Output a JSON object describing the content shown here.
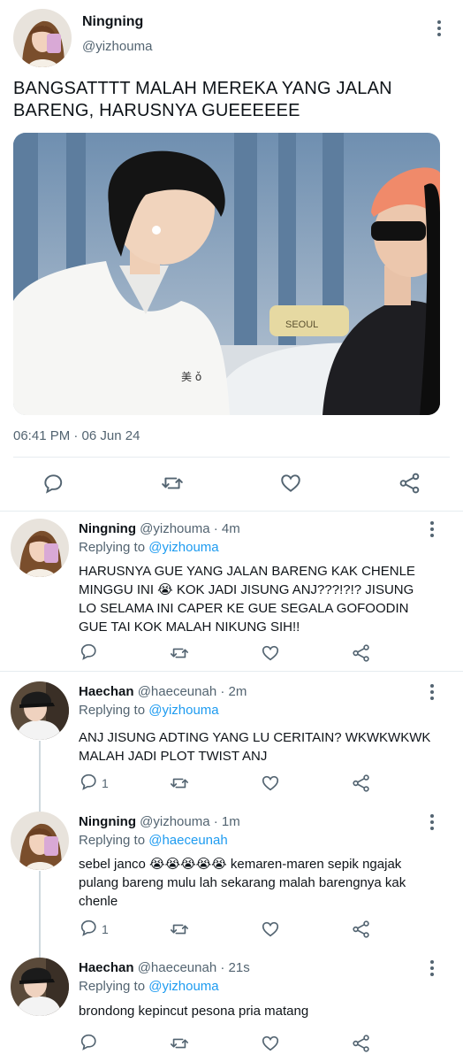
{
  "tweet": {
    "name": "Ningning",
    "handle": "@yizhouma",
    "text": "BANGSATTTT MALAH MEREKA YANG JALAN BARENG, HARUSNYA GUEEEEEE",
    "timestamp": "06:41 PM · 06 Jun 24",
    "photo_caption": "SEOUL",
    "shirt_text": "美 ǒ"
  },
  "replies": [
    {
      "name": "Ningning",
      "handle": "@yizhouma",
      "time": "· 4m",
      "replying_label": "Replying to",
      "replying_to": "@yizhouma",
      "text": "HARUSNYA GUE YANG JALAN BARENG KAK CHENLE MINGGU INI 😭 KOK JADI JISUNG ANJ???!?!? JISUNG LO SELAMA INI CAPER KE GUE SEGALA GOFOODIN GUE TAI KOK MALAH NIKUNG SIH!!",
      "reply_count": ""
    },
    {
      "name": "Haechan",
      "handle": "@haeceunah",
      "time": "· 2m",
      "replying_label": "Replying to",
      "replying_to": "@yizhouma",
      "text": "ANJ JISUNG ADTING YANG LU CERITAIN? WKWKWKWK MALAH JADI PLOT TWIST ANJ",
      "reply_count": "1"
    },
    {
      "name": "Ningning",
      "handle": "@yizhouma",
      "time": "· 1m",
      "replying_label": "Replying to",
      "replying_to": "@haeceunah",
      "text": "sebel janco 😭😭😭😭😭 kemaren-maren sepik ngajak pulang bareng mulu lah sekarang malah barengnya kak chenle",
      "reply_count": "1"
    },
    {
      "name": "Haechan",
      "handle": "@haeceunah",
      "time": "· 21s",
      "replying_label": "Replying to",
      "replying_to": "@yizhouma",
      "text": "brondong kepincut pesona pria matang",
      "reply_count": ""
    }
  ],
  "icons": {
    "reply": "reply-icon",
    "retweet": "retweet-icon",
    "like": "heart-icon",
    "share": "share-icon",
    "more": "more-vertical-icon"
  },
  "colors": {
    "text": "#0f1419",
    "secondary": "#536471",
    "link": "#1d9bf0",
    "divider": "#e6ecf0"
  }
}
